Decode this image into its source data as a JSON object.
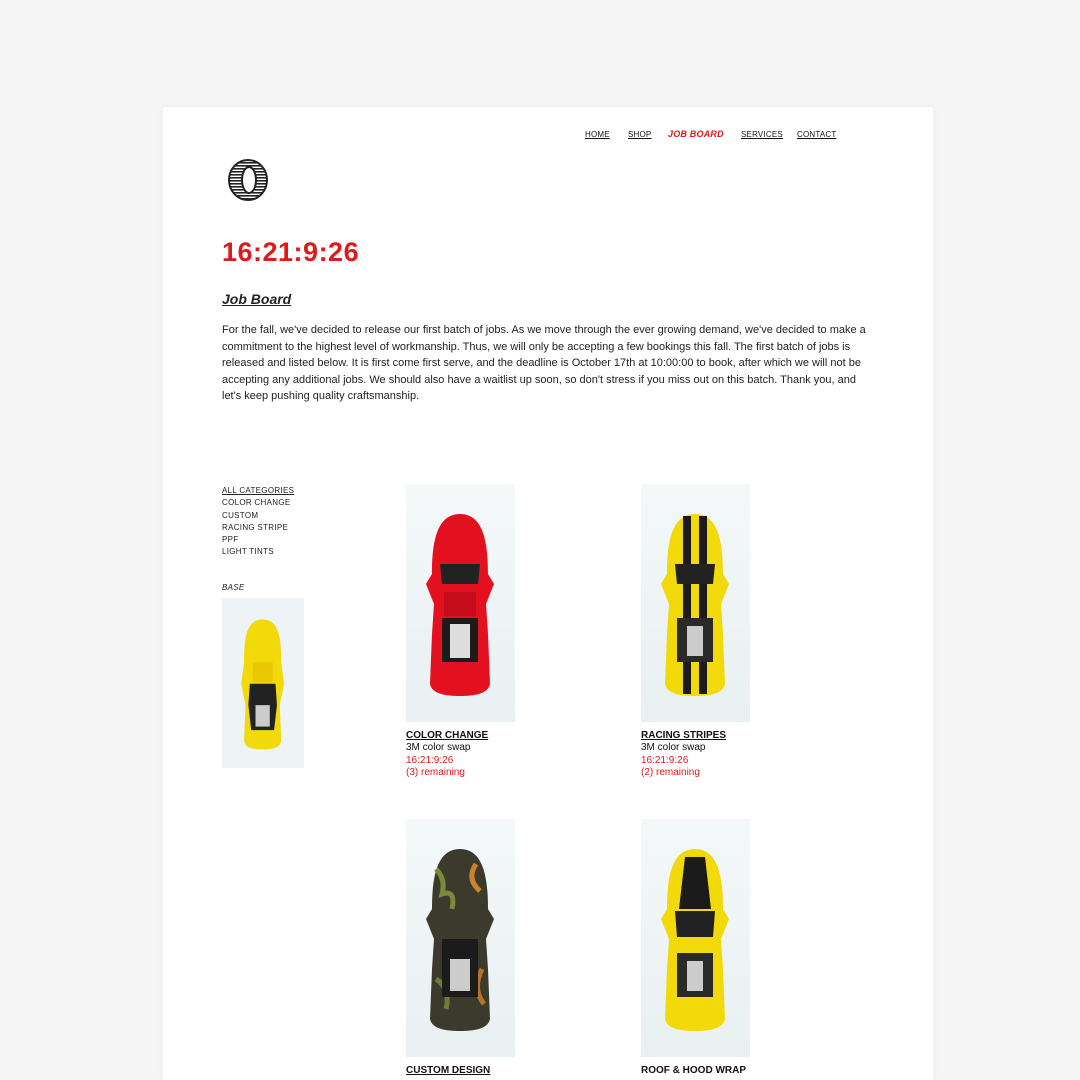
{
  "nav": {
    "home": "HOME",
    "shop": "SHOP",
    "job_board": "JOB BOARD",
    "services": "SERVICES",
    "contact": "CONTACT"
  },
  "countdown": "16:21:9:26",
  "section_title": "Job Board",
  "intro": "For the fall, we've decided to release our first batch of jobs. As we move through the ever growing demand, we've decided to make a commitment to the highest level of workmanship. Thus, we will only be accepting a few bookings this fall. The first batch of jobs is released and listed below. It is first come first serve, and the deadline is October 17th at 10:00:00 to book, after which we will not be accepting any additional jobs. We should also have a waitlist up soon, so don't stress if you miss out on this batch. Thank you, and let's keep pushing quality craftsmanship.",
  "categories": [
    "ALL CATEGORIES",
    "COLOR CHANGE",
    "CUSTOM",
    "RACING STRIPE",
    "PPF",
    "LIGHT TINTS"
  ],
  "base": {
    "label": "BASE",
    "car_color": "#f2d90a"
  },
  "products": [
    {
      "name": "COLOR CHANGE",
      "desc": "3M color swap",
      "timer": "16:21:9:26",
      "remaining": "(3) remaining",
      "car_color": "#e3101f"
    },
    {
      "name": "RACING STRIPES",
      "desc": "3M color swap",
      "timer": "16:21:9:26",
      "remaining": "(2) remaining",
      "car_color": "#f2d90a"
    },
    {
      "name": "CUSTOM DESIGN",
      "car_color": "#3c3a2c"
    },
    {
      "name": "ROOF & HOOD WRAP",
      "car_color": "#f2d90a"
    }
  ],
  "colors": {
    "accent": "#e01a1a",
    "text": "#111111"
  }
}
